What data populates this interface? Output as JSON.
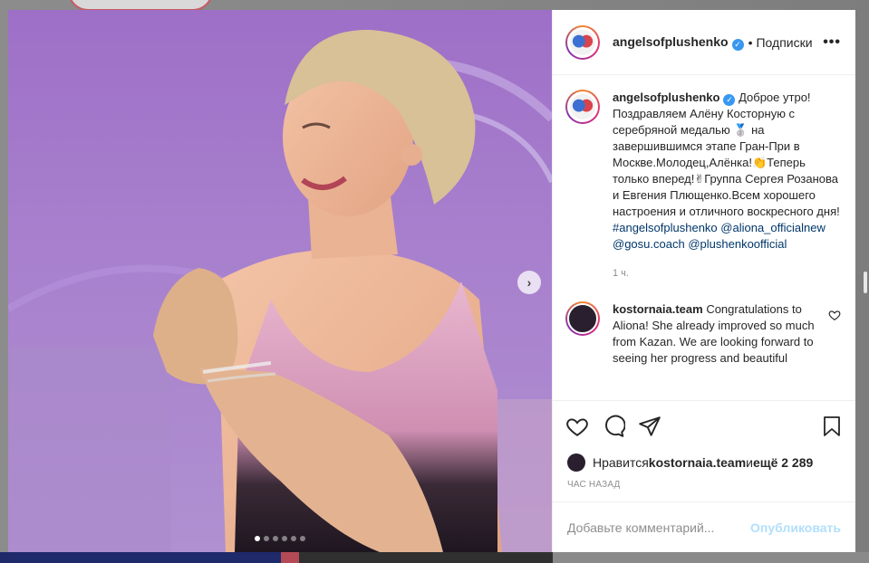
{
  "post": {
    "image_alt": "",
    "slides_count": 6,
    "active_slide": 1,
    "next_arrow": "›"
  },
  "header": {
    "username": "angelsofplushenko",
    "verified_glyph": "✓",
    "separator": "•",
    "follow_state": "Подписки",
    "more_glyph": "•••"
  },
  "caption": {
    "username": "angelsofplushenko",
    "text_1": " Доброе утро! Поздравляем Алёну Косторную с серебряной медалью ",
    "medal_emoji": "🥈",
    "text_2": " на завершившимся этапе Гран-При в Москве.Молодец,Алёнка!",
    "clap_emoji": "👏",
    "text_3": "Теперь только вперед!",
    "victory_emoji": "✌",
    "text_4": "Группа Сергея Розанова и Евгения Плющенко.Всем хорошего настроения и отличного воскресного дня! ",
    "hashtag": "#angelsofplushenko",
    "mention_1": "@aliona_officialnew",
    "mention_2": "@gosu.coach",
    "mention_3": "@plushenkoofficial",
    "time": "1 ч."
  },
  "comments": [
    {
      "username": "kostornaia.team",
      "text": " Congratulations to Aliona! She already improved so much from Kazan. We are looking forward to seeing her progress and beautiful"
    }
  ],
  "likes": {
    "prefix": "Нравится ",
    "user": "kostornaia.team",
    "middle": " и ",
    "count": "ещё 2 289"
  },
  "posted_ago": "час назад",
  "add_comment": {
    "placeholder": "Добавьте комментарий...",
    "publish_label": "Опубликовать"
  },
  "colors": {
    "link": "#00376b",
    "verified": "#3897f0",
    "publish_disabled": "#b2dffc",
    "muted": "#8e8e8e"
  }
}
